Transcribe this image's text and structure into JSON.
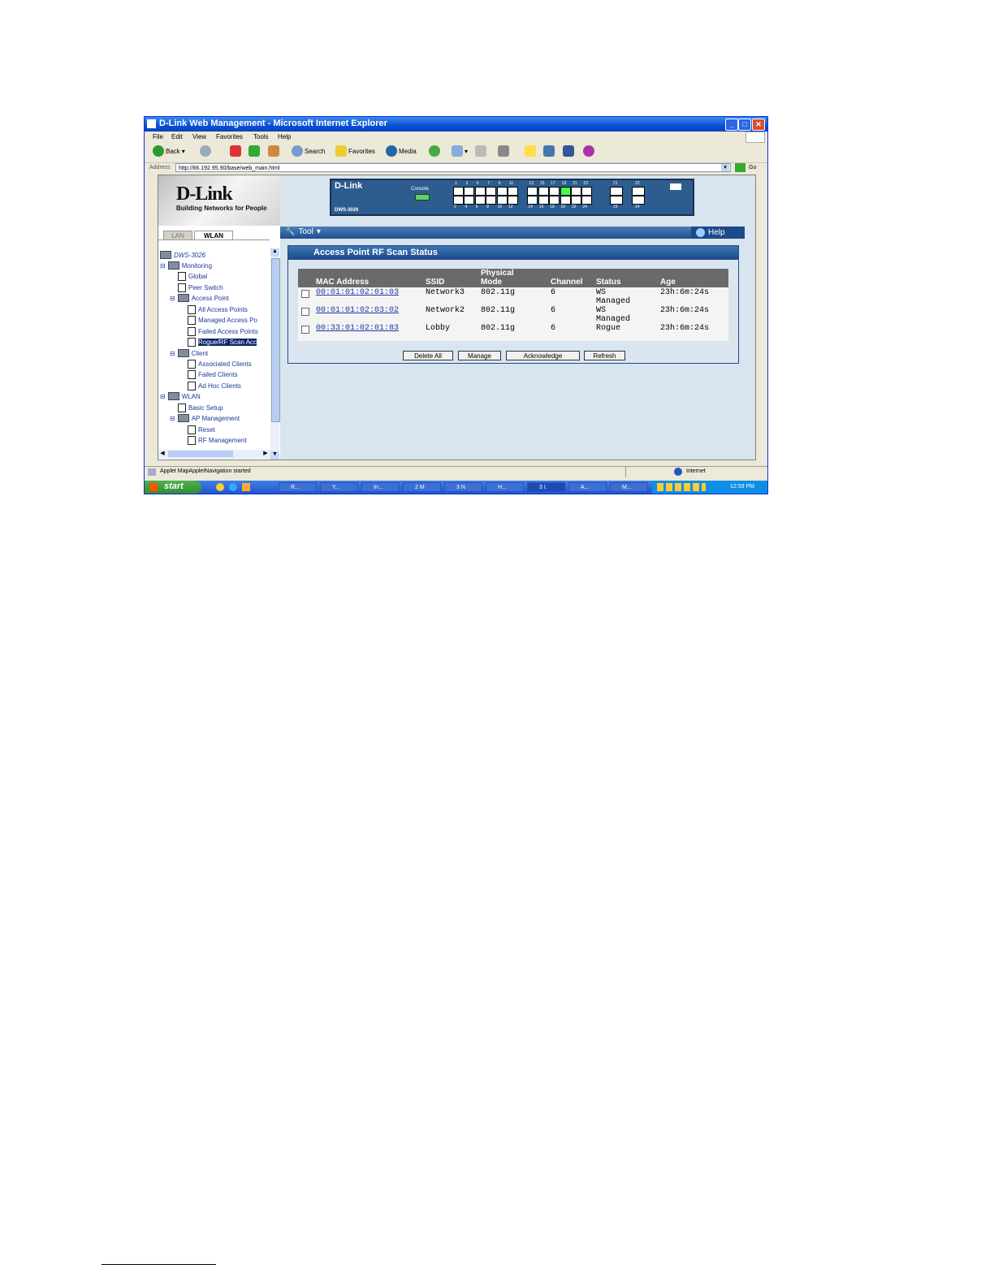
{
  "window": {
    "title": "D-Link Web Management - Microsoft Internet Explorer"
  },
  "menu": [
    "File",
    "Edit",
    "View",
    "Favorites",
    "Tools",
    "Help"
  ],
  "toolbar": {
    "back": "Back",
    "search": "Search",
    "favorites": "Favorites",
    "media": "Media"
  },
  "address": {
    "label": "Address",
    "url": "http://66.192.95.90/base/web_main.html",
    "go": "Go"
  },
  "logo": {
    "brand": "D-Link",
    "tagline": "Building Networks for People"
  },
  "tabs": {
    "lan": "LAN",
    "wlan": "WLAN"
  },
  "tree": {
    "root": "DWS-3026",
    "monitoring": "Monitoring",
    "global": "Global",
    "peer_switch": "Peer Switch",
    "access_point": "Access Point",
    "all_aps": "All Access Points",
    "managed_aps": "Managed Access Po",
    "failed_aps": "Failed Access Points",
    "rogue": "Rogue/RF Scan Acc",
    "client": "Client",
    "assoc_clients": "Associated Clients",
    "failed_clients": "Failed Clients",
    "adhoc_clients": "Ad Hoc Clients",
    "wlan": "WLAN",
    "basic_setup": "Basic Setup",
    "ap_mgmt": "AP Management",
    "reset": "Reset",
    "rf_mgmt": "RF Management"
  },
  "device": {
    "brand": "D-Link",
    "console": "Console",
    "model": "DWS-3026",
    "top_nums": [
      "1",
      "3",
      "5",
      "7",
      "9",
      "11",
      "13",
      "15",
      "17",
      "19",
      "21",
      "23"
    ],
    "bottom_nums": [
      "2",
      "4",
      "6",
      "8",
      "10",
      "12",
      "14",
      "16",
      "18",
      "20",
      "22",
      "24"
    ],
    "sfp_top": [
      "21",
      "22"
    ],
    "sfp_bottom": [
      "23",
      "24"
    ]
  },
  "toolstrip": {
    "tool": "Tool",
    "help": "Help"
  },
  "panel": {
    "title": "Access Point RF Scan Status"
  },
  "table": {
    "headers": {
      "mac": "MAC Address",
      "ssid": "SSID",
      "phys1": "Physical",
      "phys2": "Mode",
      "channel": "Channel",
      "status": "Status",
      "age": "Age"
    },
    "rows": [
      {
        "mac": "00:01:01:02:01:03",
        "ssid": "Network3",
        "mode": "802.11g",
        "channel": "6",
        "status1": "WS",
        "status2": "Managed",
        "age": "23h:6m:24s"
      },
      {
        "mac": "00:01:01:02:03:02",
        "ssid": "Network2",
        "mode": "802.11g",
        "channel": "6",
        "status1": "WS",
        "status2": "Managed",
        "age": "23h:6m:24s"
      },
      {
        "mac": "00:33:01:02:01:83",
        "ssid": "Lobby",
        "mode": "802.11g",
        "channel": "6",
        "status1": "Rogue",
        "status2": "",
        "age": "23h:6m:24s"
      }
    ]
  },
  "buttons": {
    "delete_all": "Delete All",
    "manage": "Manage",
    "acknowledge": "Acknowledge",
    "refresh": "Refresh"
  },
  "status": {
    "text": "Applet MapAppletNavigation started",
    "zone": "Internet"
  },
  "taskbar": {
    "start": "start",
    "tasks": [
      "R...",
      "Y...",
      "In...",
      "2 M",
      "3 N",
      "H...",
      "3 I.",
      "A...",
      "M..."
    ],
    "clock": "12:59 PM"
  }
}
